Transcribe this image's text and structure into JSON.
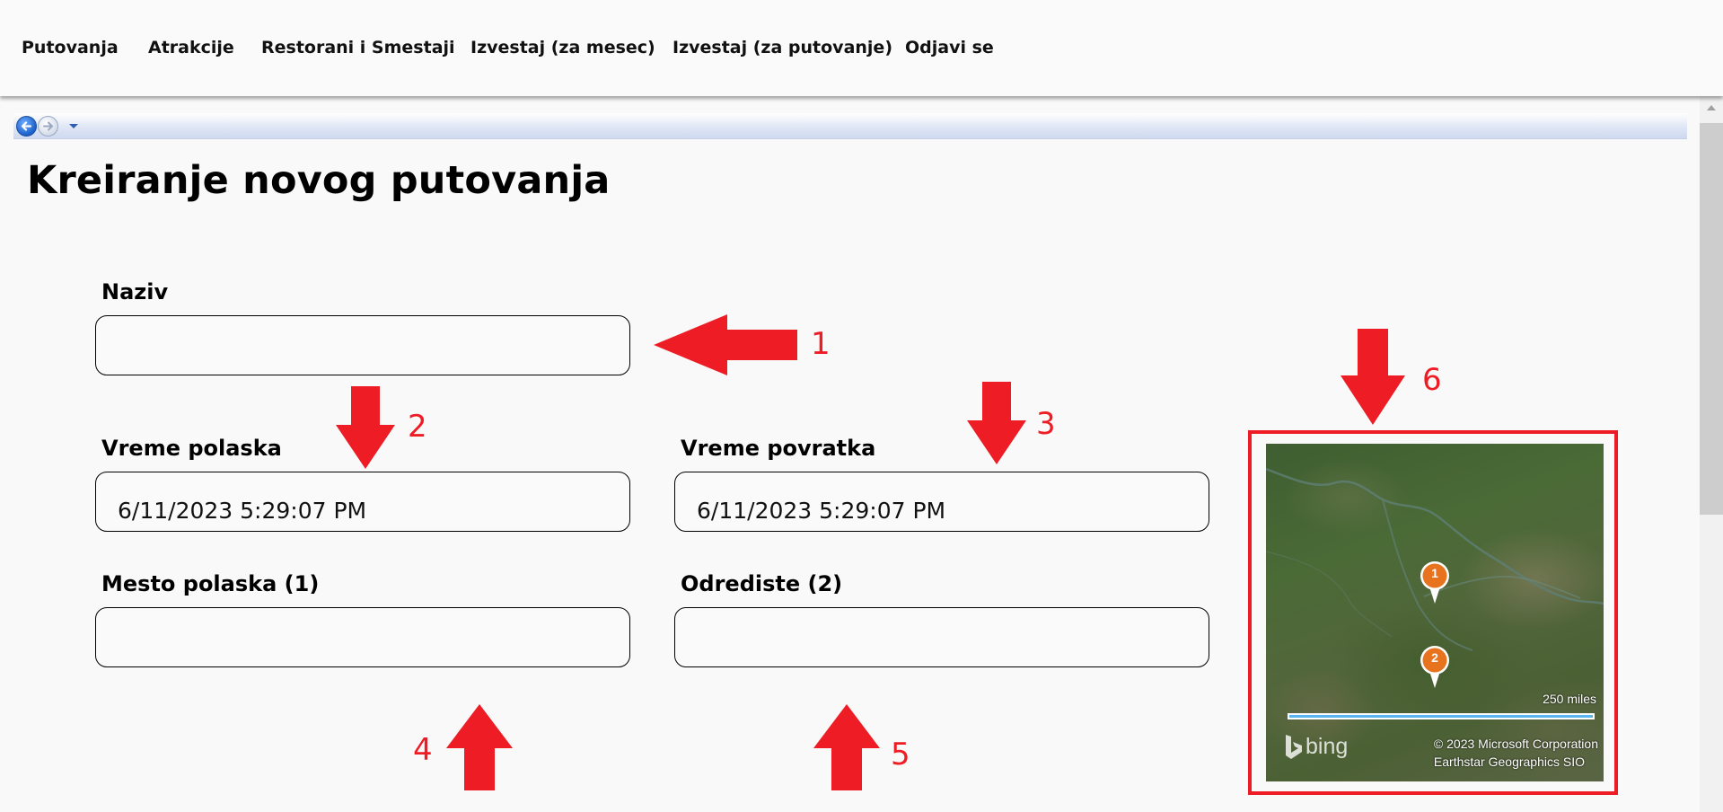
{
  "nav": {
    "items": [
      {
        "label": "Putovanja"
      },
      {
        "label": "Atrakcije"
      },
      {
        "label": "Restorani i Smestaji"
      },
      {
        "label": "Izvestaj (za mesec)"
      },
      {
        "label": "Izvestaj (za putovanje)"
      },
      {
        "label": "Odjavi se"
      }
    ]
  },
  "page": {
    "title": "Kreiranje novog putovanja"
  },
  "form": {
    "naziv": {
      "label": "Naziv",
      "value": ""
    },
    "vreme_polaska": {
      "label": "Vreme polaska",
      "value": "6/11/2023 5:29:07 PM"
    },
    "vreme_povratka": {
      "label": "Vreme povratka",
      "value": "6/11/2023 5:29:07 PM"
    },
    "mesto_polaska": {
      "label": "Mesto polaska (1)",
      "value": ""
    },
    "odrediste": {
      "label": "Odrediste (2)",
      "value": ""
    }
  },
  "annotations": {
    "n1": "1",
    "n2": "2",
    "n3": "3",
    "n4": "4",
    "n5": "5",
    "n6": "6"
  },
  "map": {
    "pins": [
      {
        "label": "1"
      },
      {
        "label": "2"
      }
    ],
    "scale": "250 miles",
    "logo": "bing",
    "copyright_line1": "© 2023 Microsoft Corporation",
    "copyright_line2": "Earthstar Geographics  SIO"
  },
  "colors": {
    "annotation_red": "#ee1c25",
    "pin_orange": "#e8731e",
    "scale_blue": "#5ab4f0"
  },
  "icons": {
    "back": "arrow-left-icon",
    "forward": "arrow-right-icon",
    "dropdown": "chevron-down-icon"
  }
}
